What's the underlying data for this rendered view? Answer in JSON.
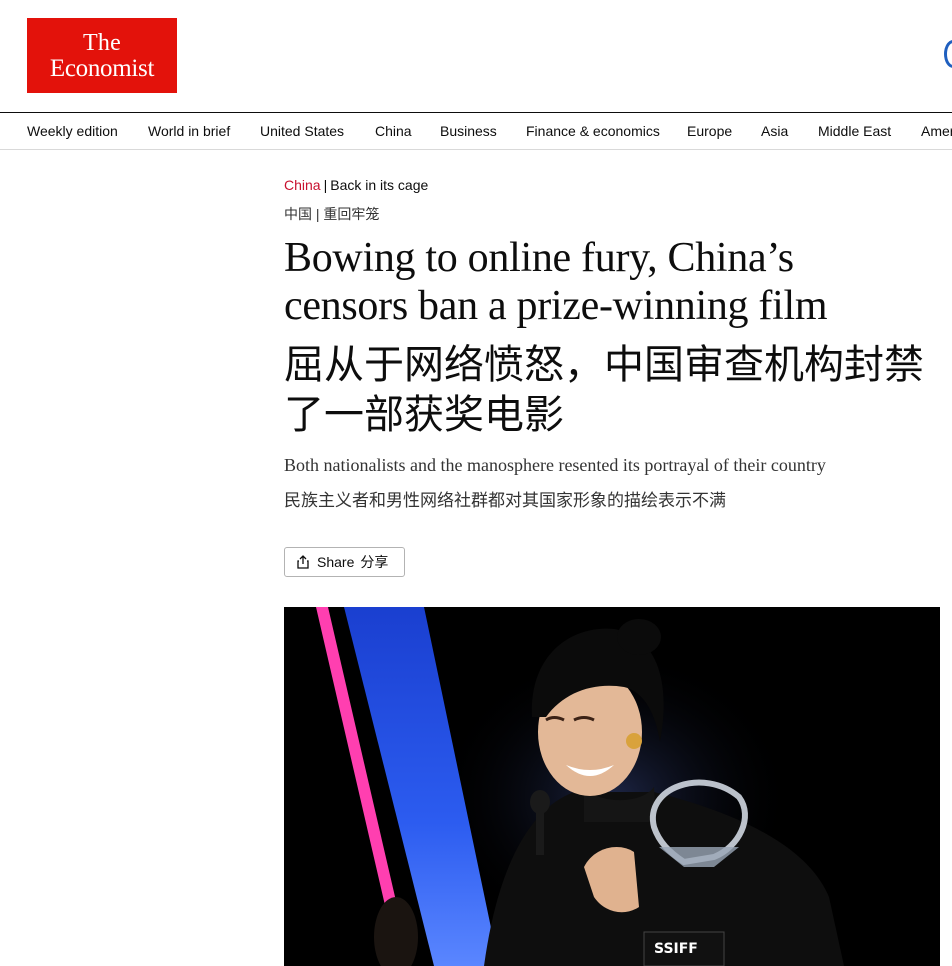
{
  "logo": {
    "line1": "The",
    "line2": "Economist"
  },
  "nav": {
    "items": [
      "Weekly edition",
      "World in brief",
      "United States",
      "China",
      "Business",
      "Finance & economics",
      "Europe",
      "Asia",
      "Middle East",
      "Amer"
    ]
  },
  "article": {
    "section": "China",
    "rubric_sep": "|",
    "rubric": "Back in its cage",
    "rubric_zh": "中国 | 重回牢笼",
    "headline": "Bowing to online fury, China’s censors ban a prize-winning film",
    "headline_zh": "屈从于网络愤怒，中国审查机构封禁了一部获奖电影",
    "standfirst": "Both nationalists and the manosphere resented its portrayal of their country",
    "standfirst_zh": "民族主义者和男性网络社群都对其国家形象的描绘表示不满",
    "share_label": "Share",
    "share_label_zh": "分享"
  },
  "photo": {
    "trophy_text": "SSIFF",
    "colors": {
      "pink_beam": "#ff3fb0",
      "blue_beam": "#1f4fe0",
      "background": "#000000"
    }
  },
  "colors": {
    "brand_red": "#e3120b",
    "section_red": "#c8102e"
  }
}
